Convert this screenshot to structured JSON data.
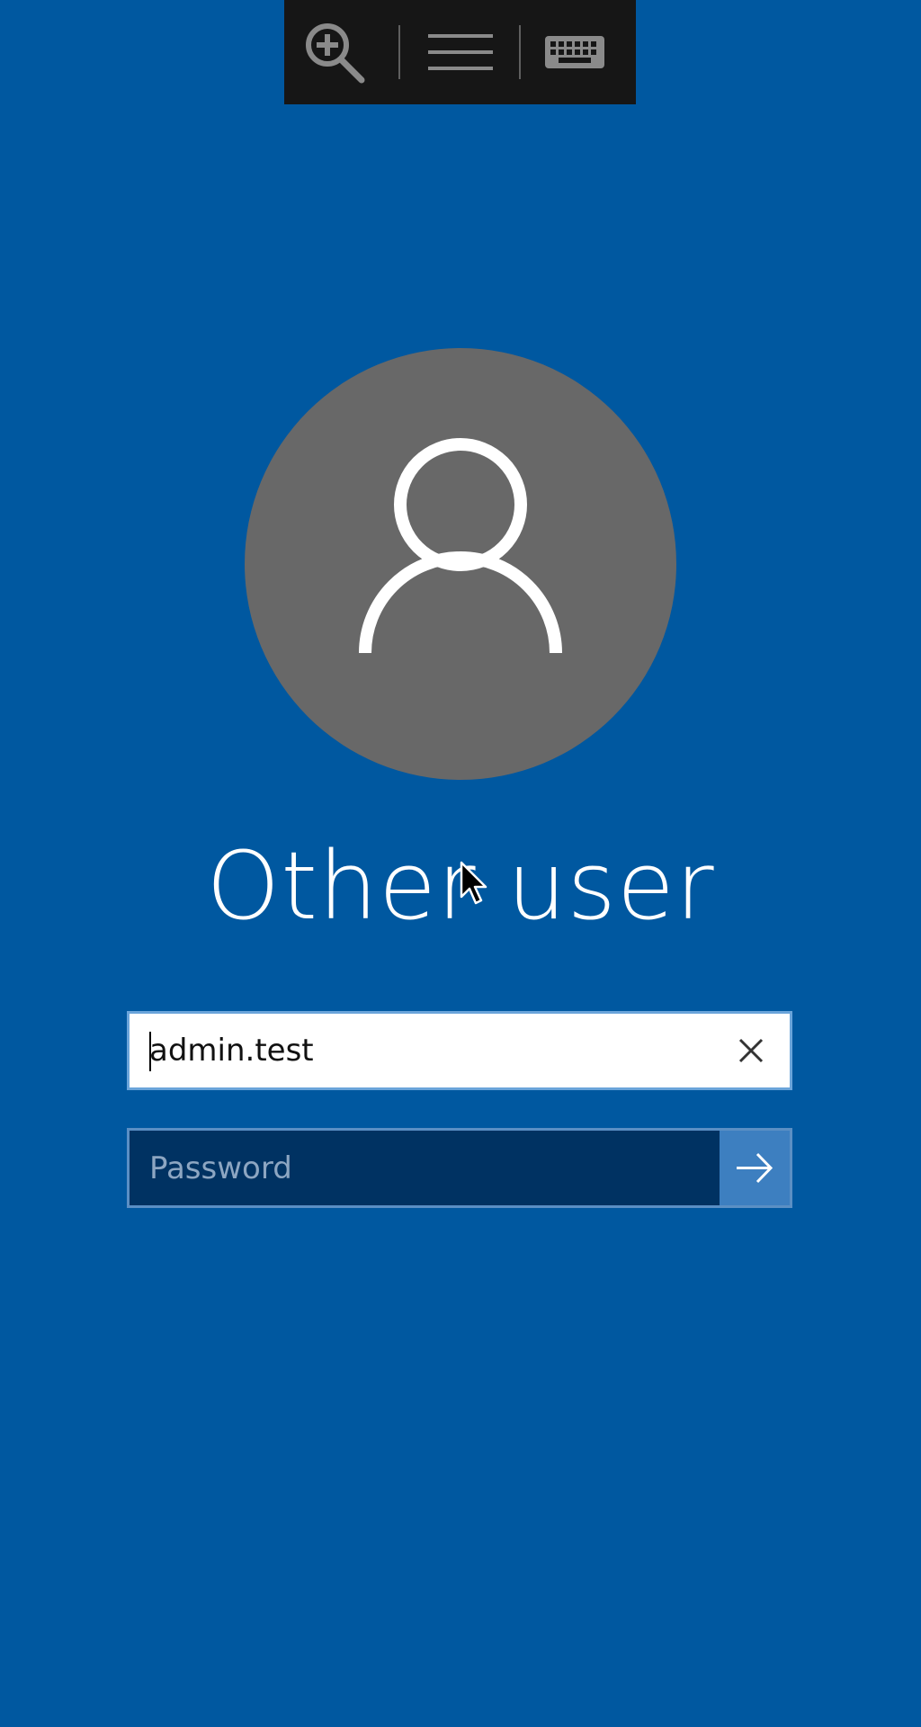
{
  "toolbar": {
    "items": [
      {
        "icon": "magnifier-zoom-icon"
      },
      {
        "icon": "hamburger-menu-icon"
      },
      {
        "icon": "on-screen-keyboard-icon"
      }
    ]
  },
  "user": {
    "display_name": "Other user",
    "avatar_icon": "user-silhouette-icon"
  },
  "username_field": {
    "value": "admin.test",
    "clear_icon": "close-x-icon"
  },
  "password_field": {
    "placeholder": "Password",
    "value": "",
    "submit_icon": "arrow-right-icon"
  },
  "colors": {
    "background": "#0058a0",
    "toolbar": "#161616",
    "avatar": "#686868",
    "password_bg": "#003262",
    "submit_bg": "#3d7fc0"
  }
}
